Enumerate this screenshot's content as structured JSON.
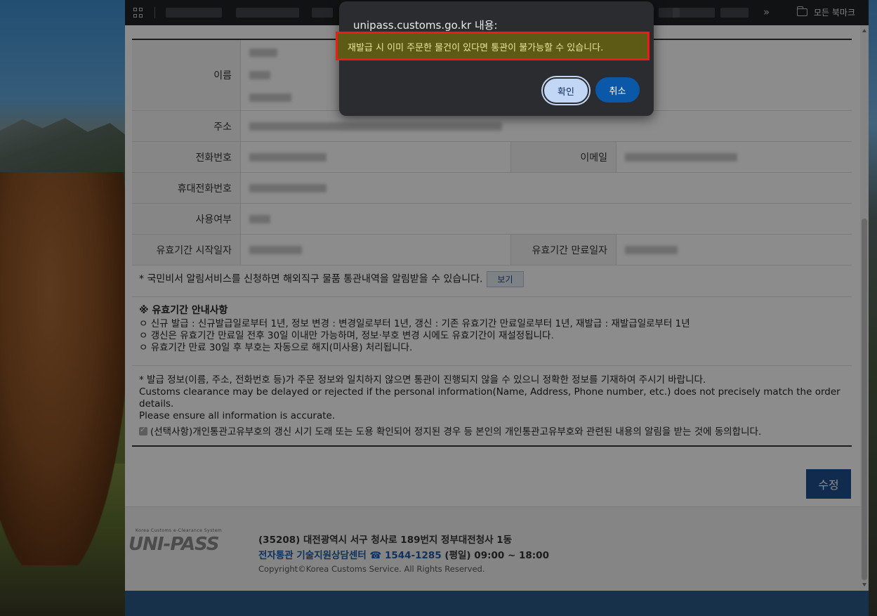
{
  "bookmarks_bar": {
    "all_bookmarks": "모든 북마크",
    "more": "»"
  },
  "form": {
    "rows": [
      {
        "label": "이름"
      },
      {
        "label": "주소"
      },
      {
        "label": "전화번호",
        "label2": "이메일"
      },
      {
        "label": "휴대전화번호"
      },
      {
        "label": "사용여부"
      },
      {
        "label": "유효기간 시작일자",
        "label2": "유효기간 만료일자"
      }
    ]
  },
  "notice": {
    "text": "* 국민비서 알림서비스를 신청하면 해외직구 물품 통관내역을 알림받을 수 있습니다.",
    "view_button": "보기"
  },
  "guide": {
    "title": "※ 유효기간 안내사항",
    "items": [
      "ㅇ 신규 발급 : 신규발급일로부터 1년, 정보 변경 : 변경일로부터 1년, 갱신 : 기존 유효기간 만료일로부터 1년, 재발급 : 재발급일로부터 1년",
      "ㅇ 갱신은 유효기간 만료일 전후 30일 이내만 가능하며, 정보·부호 변경 시에도 유효기간이 재설정됩니다.",
      "ㅇ 유효기간 만료 30일 후 부호는 자동으로 해지(미사용) 처리됩니다."
    ]
  },
  "warning": {
    "ko": "* 발급 정보(이름, 주소, 전화번호 등)가 주문 정보와 일치하지 않으면 통관이 진행되지 않을 수 있으니 정확한 정보를 기재하여 주시기 바랍니다.",
    "en1": "Customs clearance may be delayed or rejected if the personal information(Name, Address, Phone number, etc.) does not precisely match the order details.",
    "en2": "Please ensure all information is accurate."
  },
  "agree": {
    "text": "(선택사항)개인통관고유부호의 갱신 시기 도래 또는 도용 확인되어 정지된 경우 등 본인의 개인통관고유부호와 관련된 내용의 알림을 받는 것에 동의합니다.",
    "checked": true
  },
  "edit_button": "수정",
  "footer": {
    "logo_small": "Korea Customs e-Clearance System",
    "logo_main": "UNI-PASS",
    "address": "(35208) 대전광역시 서구 청사로 189번지 정부대전청사 1동",
    "center_label": "전자통관 기술지원상담센터",
    "phone": "☎ 1544-1285",
    "hours": "(평일) 09:00 ~ 18:00",
    "copyright": "Copyright©Korea Customs Service. All Rights Reserved."
  },
  "dialog": {
    "title": "unipass.customs.go.kr 내용:",
    "message": "재발급 시 이미 주문한 물건이 있다면 통관이 불가능할 수 있습니다.",
    "ok": "확인",
    "cancel": "취소"
  }
}
